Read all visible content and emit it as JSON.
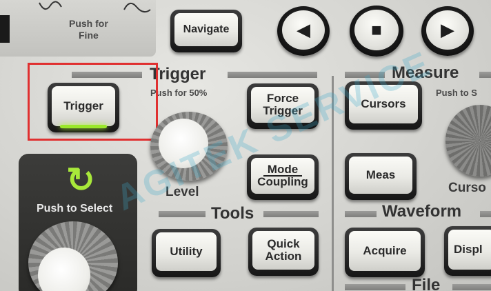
{
  "top": {
    "push_for_fine": "Push for\nFine",
    "navigate": "Navigate",
    "nav_prev_glyph": "◀",
    "nav_stop_glyph": "■",
    "nav_next_glyph": "▶"
  },
  "trigger": {
    "title": "Trigger",
    "push_hint": "Push for 50%",
    "trigger_button": "Trigger",
    "force_trigger": "Force\nTrigger",
    "level_label": "Level",
    "mode_coupling": "Mode\nCoupling"
  },
  "measure": {
    "title": "Measure",
    "push_hint": "Push to S",
    "cursors": "Cursors",
    "meas": "Meas",
    "cursor_knob_label": "Curso"
  },
  "select": {
    "push_to_select": "Push to Select",
    "icon_glyph": "↻"
  },
  "tools": {
    "title": "Tools",
    "utility": "Utility",
    "quick_action": "Quick\nAction"
  },
  "waveform": {
    "title": "Waveform",
    "acquire": "Acquire",
    "display": "Displ"
  },
  "file": {
    "title": "File"
  },
  "watermark": "AGITEK SERVICE",
  "colors": {
    "highlight": "#e03030",
    "trigger_led": "#9ae82a",
    "select_icon": "#a8e83a"
  }
}
